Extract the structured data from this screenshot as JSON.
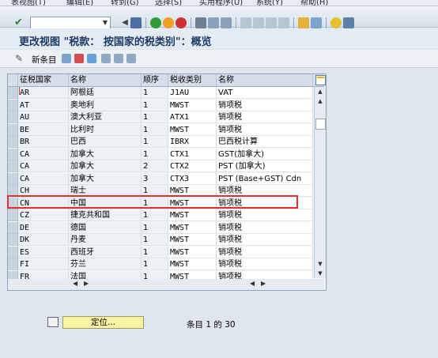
{
  "menu": [
    "表视图(T)",
    "编辑(E)",
    "转到(G)",
    "选择(S)",
    "实用程序(U)",
    "系统(Y)",
    "帮助(H)"
  ],
  "toolbar": {
    "command_value": ""
  },
  "screen_title": "更改视图 \"税款： 按国家的税类别\"：概览",
  "app_toolbar": {
    "new_entries_label": "新条目"
  },
  "table": {
    "columns": [
      "征税国家",
      "名称",
      "顺序",
      "税收类别",
      "名称"
    ],
    "rows": [
      [
        "AR",
        "阿根廷",
        "1",
        "J1AU",
        "VAT"
      ],
      [
        "AT",
        "奥地利",
        "1",
        "MWST",
        "销项税"
      ],
      [
        "AU",
        "澳大利亚",
        "1",
        "ATX1",
        "销项税"
      ],
      [
        "BE",
        "比利时",
        "1",
        "MWST",
        "销项税"
      ],
      [
        "BR",
        "巴西",
        "1",
        "IBRX",
        "巴西税计算"
      ],
      [
        "CA",
        "加拿大",
        "1",
        "CTX1",
        "GST(加拿大)"
      ],
      [
        "CA",
        "加拿大",
        "2",
        "CTX2",
        "PST (加拿大)"
      ],
      [
        "CA",
        "加拿大",
        "3",
        "CTX3",
        "PST (Base+GST) Cdn"
      ],
      [
        "CH",
        "瑞士",
        "1",
        "MWST",
        "销项税"
      ],
      [
        "CN",
        "中国",
        "1",
        "MWST",
        "销项税"
      ],
      [
        "CZ",
        "捷克共和国",
        "1",
        "MWST",
        "销项税"
      ],
      [
        "DE",
        "德国",
        "1",
        "MWST",
        "销项税"
      ],
      [
        "DK",
        "丹麦",
        "1",
        "MWST",
        "销项税"
      ],
      [
        "ES",
        "西班牙",
        "1",
        "MWST",
        "销项税"
      ],
      [
        "FI",
        "芬兰",
        "1",
        "MWST",
        "销项税"
      ],
      [
        "FR",
        "法国",
        "1",
        "MWST",
        "销项税"
      ]
    ]
  },
  "footer": {
    "locate_label": "定位...",
    "entry_count": "条目 1 的 30"
  },
  "colors": {
    "highlight": "#e03030",
    "title": "#1d3b66"
  }
}
